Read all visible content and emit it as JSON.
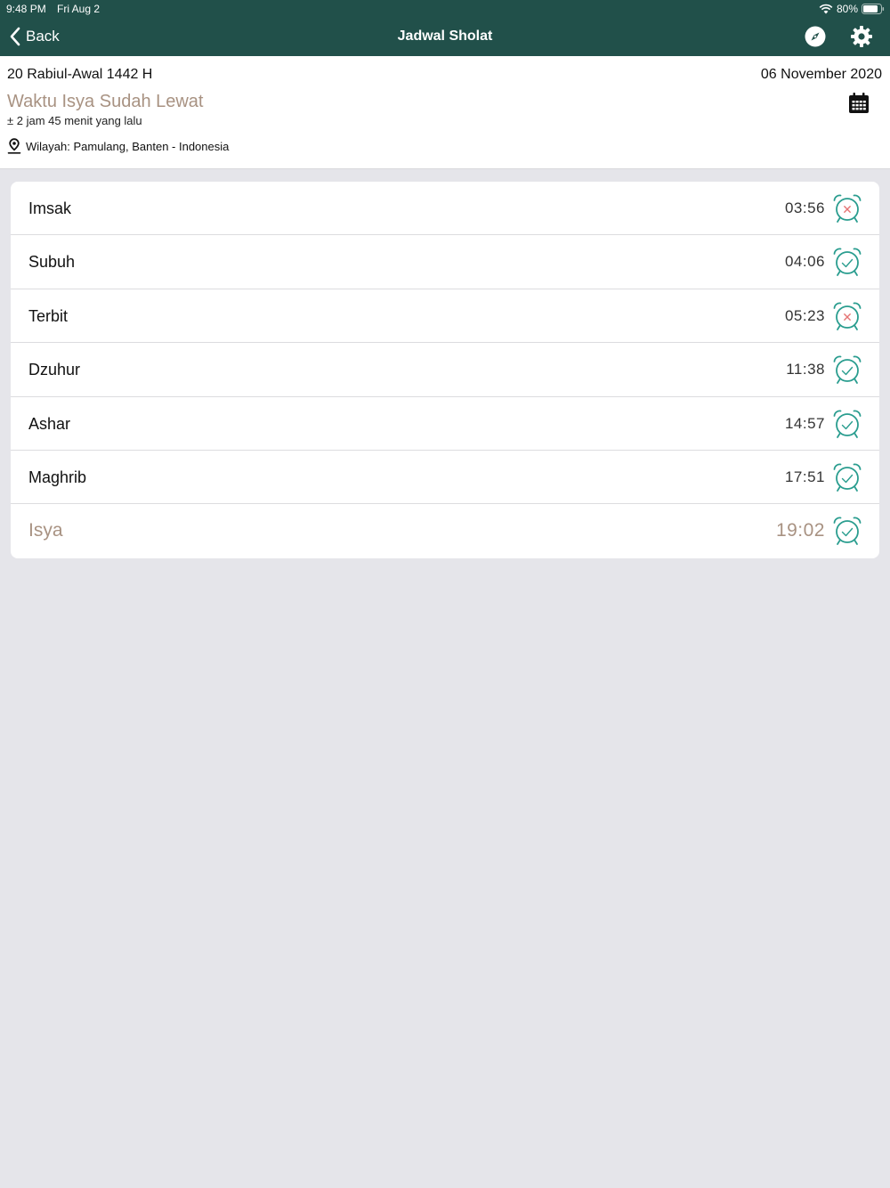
{
  "status_bar": {
    "time": "9:48 PM",
    "day": "Fri Aug 2",
    "battery": "80%"
  },
  "nav": {
    "back_label": "Back",
    "title": "Jadwal Sholat",
    "compass_icon": "compass-icon",
    "settings_icon": "gear-icon"
  },
  "header": {
    "hijri_date": "20 Rabiul-Awal 1442 H",
    "gregorian_date": "06 November 2020",
    "status_message": "Waktu Isya Sudah Lewat",
    "time_ago": "± 2 jam 45 menit yang lalu",
    "region": "Wilayah: Pamulang, Banten - Indonesia",
    "calendar_icon": "calendar-icon",
    "location_icon": "location-pin-icon"
  },
  "prayers": [
    {
      "name": "Imsak",
      "time": "03:56",
      "alarm": "off"
    },
    {
      "name": "Subuh",
      "time": "04:06",
      "alarm": "on"
    },
    {
      "name": "Terbit",
      "time": "05:23",
      "alarm": "off"
    },
    {
      "name": "Dzuhur",
      "time": "11:38",
      "alarm": "on"
    },
    {
      "name": "Ashar",
      "time": "14:57",
      "alarm": "on"
    },
    {
      "name": "Maghrib",
      "time": "17:51",
      "alarm": "on"
    },
    {
      "name": "Isya",
      "time": "19:02",
      "alarm": "on",
      "current": true
    }
  ],
  "colors": {
    "nav_bg": "#21504a",
    "accent_teal": "#2a9d8f",
    "alarm_off_x": "#e57373",
    "highlight_text": "#a89282"
  }
}
